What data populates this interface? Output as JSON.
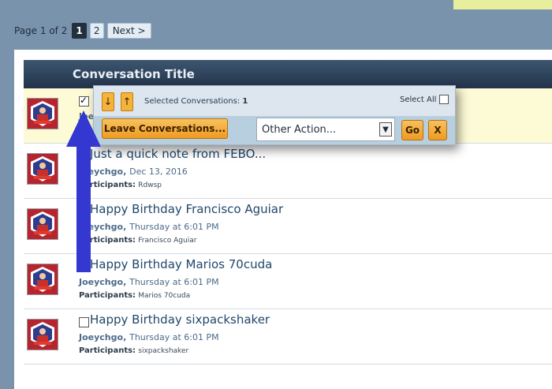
{
  "pagination": {
    "label": "Page 1 of 2",
    "pages": [
      "1",
      "2"
    ],
    "current": "1",
    "next_label": "Next >"
  },
  "list": {
    "header": "Conversation Title",
    "rows": [
      {
        "title": "",
        "author": "Joeychgo",
        "date": "",
        "participants_label": "",
        "participants": "",
        "checked": true
      },
      {
        "title": "Just a quick note from FEBO...",
        "author": "Joeychgo",
        "date": "Dec 13, 2016",
        "participants_label": "Participants:",
        "participants": "Rdwsp",
        "checked": false
      },
      {
        "title": "Happy Birthday Francisco Aguiar",
        "author": "Joeychgo",
        "date": "Thursday at 6:01 PM",
        "participants_label": "Participants:",
        "participants": "Francisco Aguiar",
        "checked": false
      },
      {
        "title": "Happy Birthday Marios 70cuda",
        "author": "Joeychgo",
        "date": "Thursday at 6:01 PM",
        "participants_label": "Participants:",
        "participants": "Marios 70cuda",
        "checked": false
      },
      {
        "title": "Happy Birthday sixpackshaker",
        "author": "Joeychgo",
        "date": "Thursday at 6:01 PM",
        "participants_label": "Participants:",
        "participants": "sixpackshaker",
        "checked": false
      }
    ]
  },
  "popup": {
    "sort_down_icon": "↓",
    "sort_up_icon": "↑",
    "selected_label": "Selected Conversations:",
    "selected_count": "1",
    "select_all_label": "Select All",
    "leave_button": "Leave Conversations...",
    "other_action_value": "Other Action...",
    "go_button": "Go",
    "close_button": "X"
  },
  "colors": {
    "background": "#7a93ad",
    "header": "#2c4058",
    "accent_orange": "#f2a530",
    "arrow_blue": "#3438d0",
    "highlight_row": "#fdfbd6"
  }
}
